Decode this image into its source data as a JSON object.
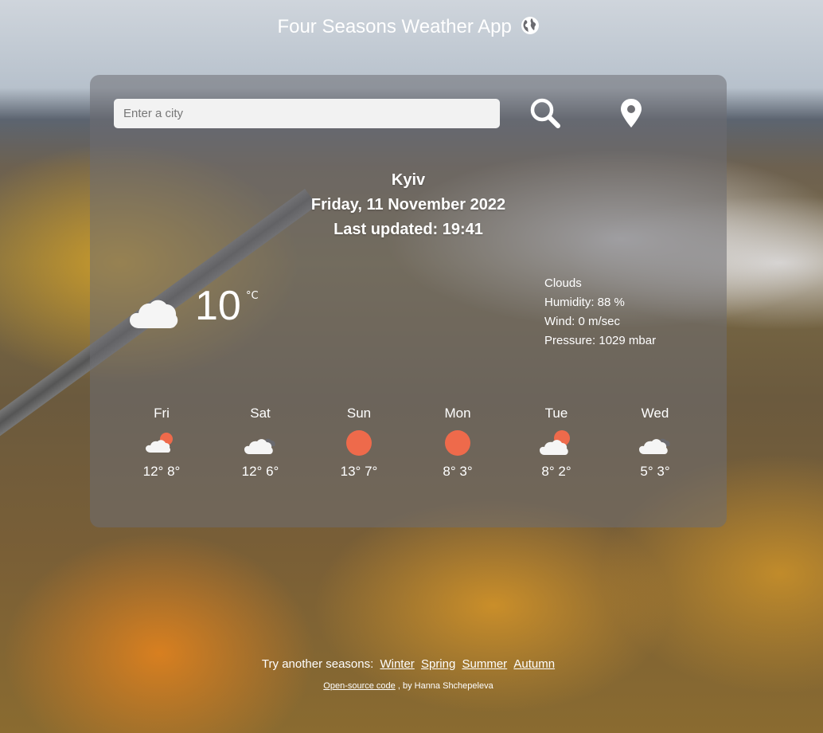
{
  "header": {
    "title": "Four Seasons Weather App",
    "icon": "globe-icon"
  },
  "search": {
    "placeholder": "Enter a city",
    "value": ""
  },
  "location": {
    "city": "Kyiv",
    "date": "Friday, 11 November 2022",
    "updated": "Last updated: 19:41"
  },
  "current": {
    "temperature": "10",
    "unit": "°C",
    "icon": "cloud-icon",
    "description": "Clouds",
    "humidity": "Humidity: 88 %",
    "wind": "Wind: 0 m/sec",
    "pressure": "Pressure: 1029 mbar"
  },
  "forecast": [
    {
      "day": "Fri",
      "max": "12°",
      "min": "8°",
      "icon": "partly-cloudy-sun-icon"
    },
    {
      "day": "Sat",
      "max": "12°",
      "min": "6°",
      "icon": "cloud-icon"
    },
    {
      "day": "Sun",
      "max": "13°",
      "min": "7°",
      "icon": "sun-icon"
    },
    {
      "day": "Mon",
      "max": "8°",
      "min": "3°",
      "icon": "sun-icon"
    },
    {
      "day": "Tue",
      "max": "8°",
      "min": "2°",
      "icon": "partly-cloudy-sun-icon"
    },
    {
      "day": "Wed",
      "max": "5°",
      "min": "3°",
      "icon": "cloud-icon"
    }
  ],
  "footer": {
    "prefix": "Try another seasons:",
    "seasons": [
      "Winter",
      "Spring",
      "Summer",
      "Autumn"
    ],
    "source_link": "Open-source code",
    "author": ", by Hanna Shchepeleva"
  },
  "colors": {
    "sun": "#ee6a4b",
    "panel": "#6e6e73",
    "cloud": "#f5f5f5"
  }
}
